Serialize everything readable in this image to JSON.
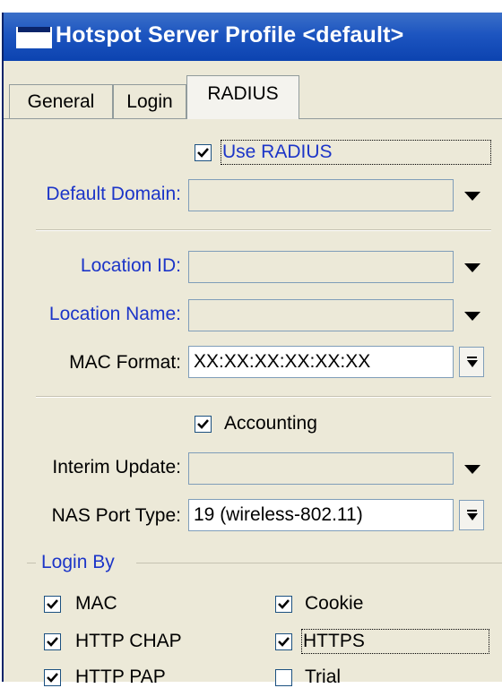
{
  "window": {
    "title": "Hotspot Server Profile <default>"
  },
  "tabs": [
    {
      "label": "General"
    },
    {
      "label": "Login"
    },
    {
      "label": "RADIUS",
      "active": true
    }
  ],
  "radius": {
    "use_radius": {
      "label": "Use RADIUS",
      "checked": true
    },
    "default_domain": {
      "label": "Default Domain:",
      "value": ""
    },
    "location_id": {
      "label": "Location ID:",
      "value": ""
    },
    "location_name": {
      "label": "Location Name:",
      "value": ""
    },
    "mac_format": {
      "label": "MAC Format:",
      "value": "XX:XX:XX:XX:XX:XX"
    },
    "accounting": {
      "label": "Accounting",
      "checked": true
    },
    "interim_update": {
      "label": "Interim Update:",
      "value": ""
    },
    "nas_port_type": {
      "label": "NAS Port Type:",
      "value": "19 (wireless-802.11)"
    }
  },
  "login_by": {
    "title": "Login By",
    "options": [
      {
        "label": "MAC",
        "checked": true
      },
      {
        "label": "Cookie",
        "checked": true
      },
      {
        "label": "HTTP CHAP",
        "checked": true
      },
      {
        "label": "HTTPS",
        "checked": true
      },
      {
        "label": "HTTP PAP",
        "checked": true
      },
      {
        "label": "Trial",
        "checked": false
      }
    ]
  },
  "colors": {
    "title_bar": "#1d55c0",
    "label_blue": "#1c35c8",
    "dialog_bg": "#ece9d8"
  }
}
